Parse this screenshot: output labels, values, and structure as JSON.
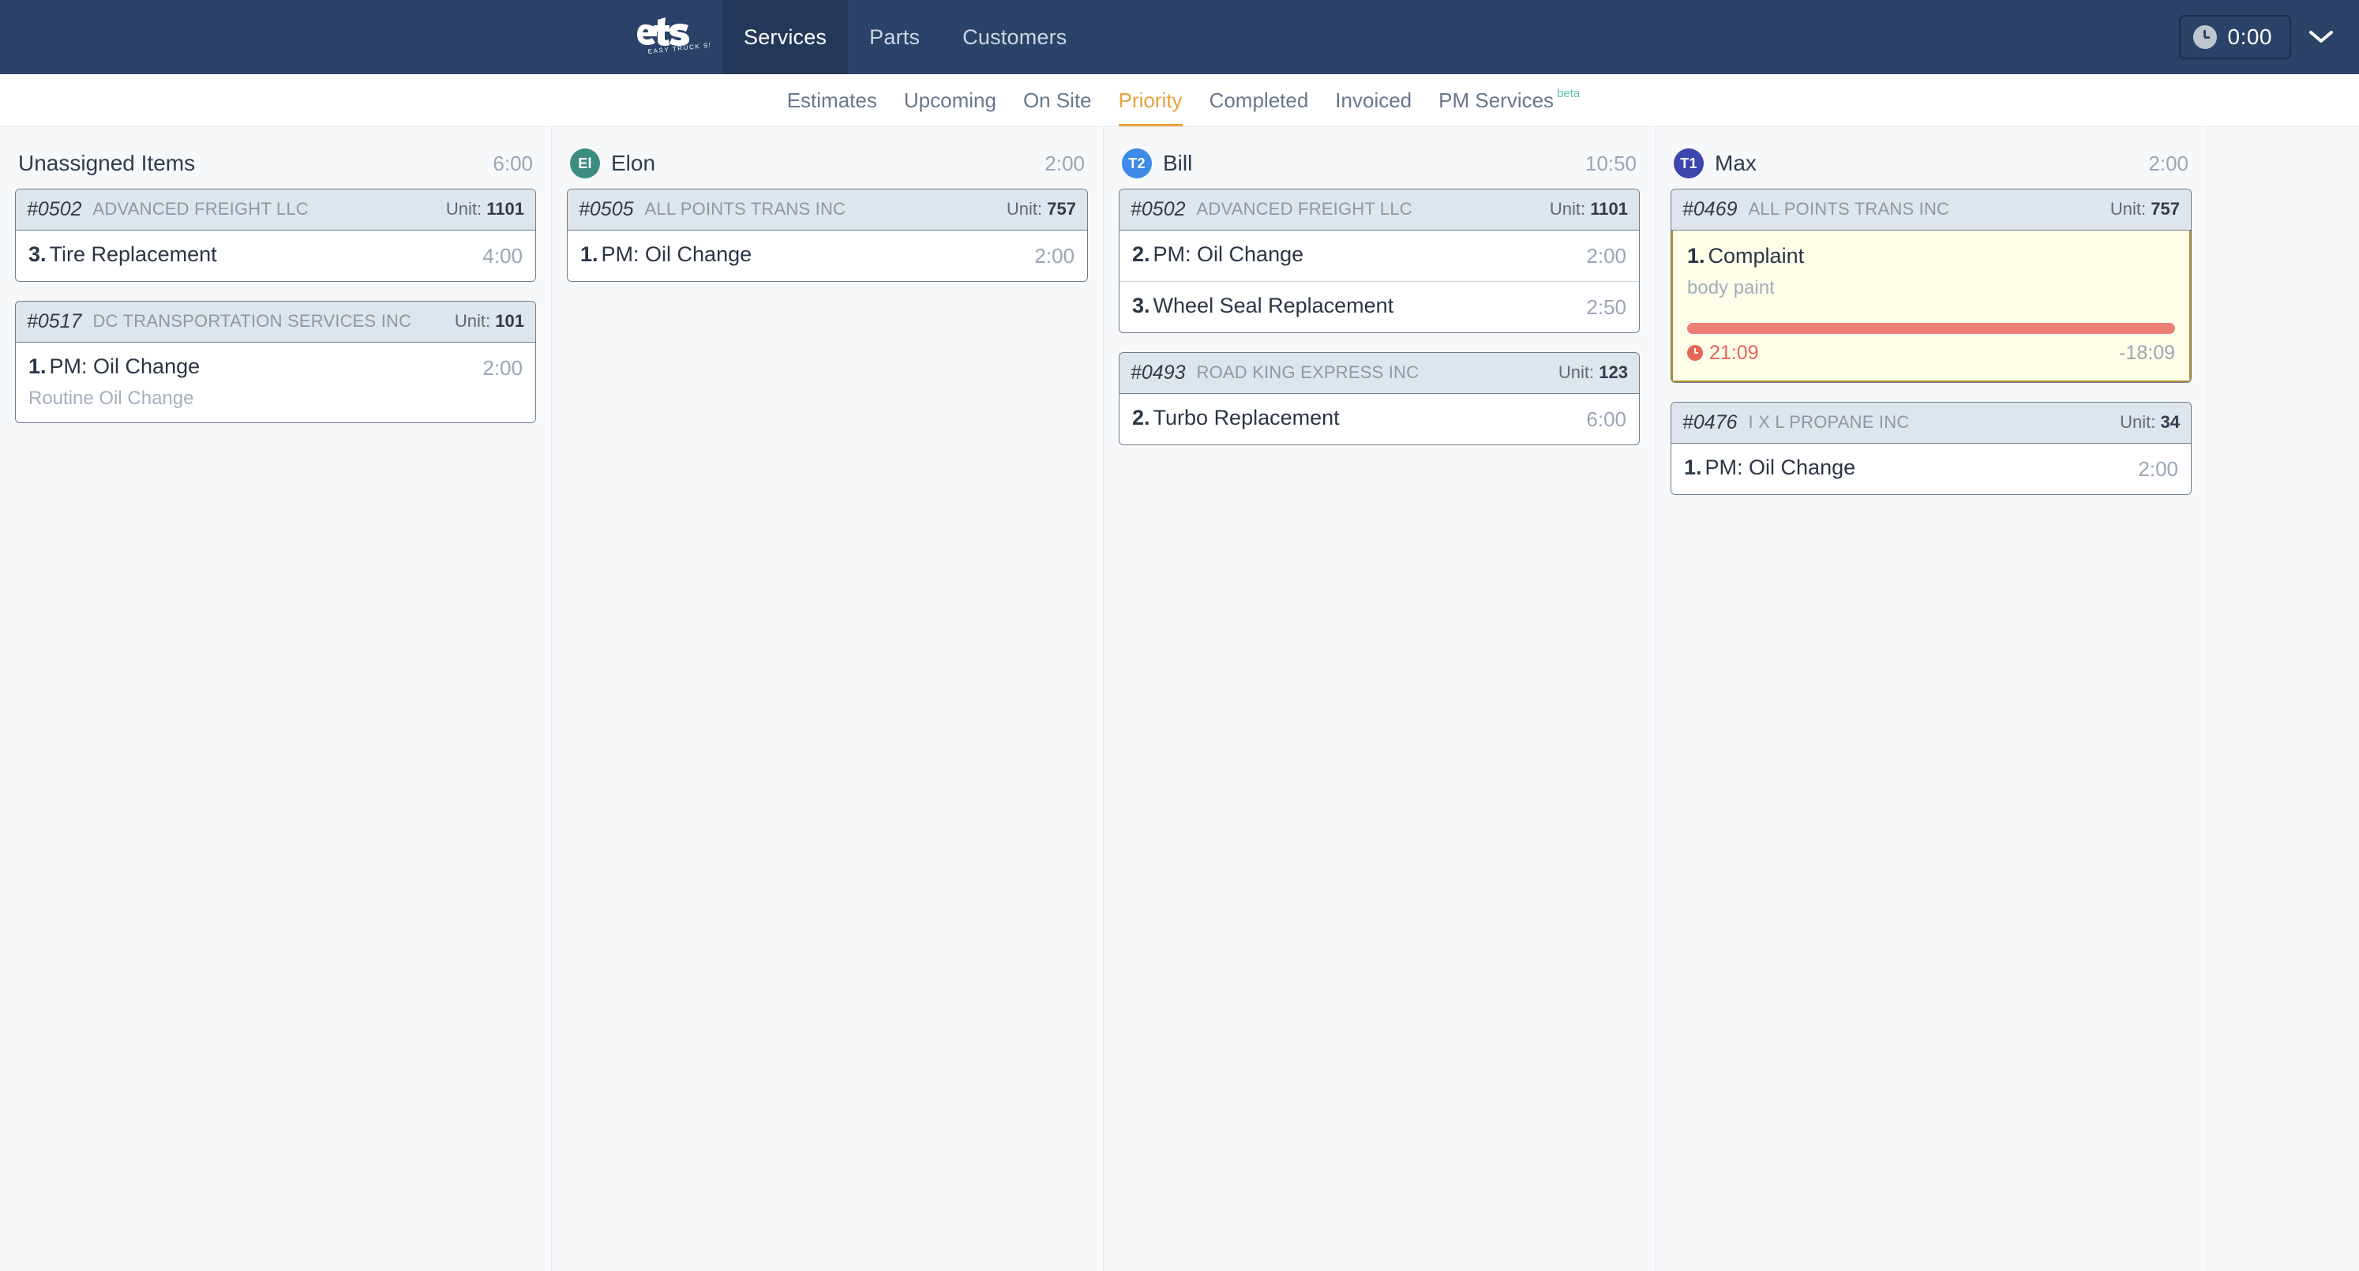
{
  "topbar": {
    "logo_name": "ets-logo",
    "logo_text": "ets",
    "logo_tagline": "EASY TRUCK SHOP",
    "nav": [
      {
        "label": "Services",
        "active": true
      },
      {
        "label": "Parts",
        "active": false
      },
      {
        "label": "Customers",
        "active": false
      }
    ],
    "timer": {
      "icon": "clock-icon",
      "value": "0:00"
    },
    "chevron": "chevron-down-icon"
  },
  "tabs": [
    {
      "label": "Estimates",
      "active": false
    },
    {
      "label": "Upcoming",
      "active": false
    },
    {
      "label": "On Site",
      "active": false
    },
    {
      "label": "Priority",
      "active": true
    },
    {
      "label": "Completed",
      "active": false
    },
    {
      "label": "Invoiced",
      "active": false
    },
    {
      "label": "PM Services",
      "active": false,
      "badge": "beta"
    }
  ],
  "colors": {
    "topbar_bg": "#2b4368",
    "accent": "#e8a33d",
    "beta": "#5bbfb0",
    "overdue": "#e8655c",
    "progress_bar": "#ec8078",
    "highlight_bg": "#fdfde8",
    "highlight_border": "#b08c2b"
  },
  "columns": [
    {
      "id": "unassigned",
      "title": "Unassigned Items",
      "total": "6:00",
      "avatar": null,
      "work_orders": [
        {
          "number": "#0502",
          "customer": "ADVANCED FREIGHT LLC",
          "unit_label": "Unit:",
          "unit": "1101",
          "wrap_unit": false,
          "tasks": [
            {
              "index": "3.",
              "title": "Tire Replacement",
              "sub": null,
              "time": "4:00",
              "highlight": false
            }
          ]
        },
        {
          "number": "#0517",
          "customer": "DC TRANSPORTATION SERVICES INC",
          "unit_label": "Unit:",
          "unit": "101",
          "wrap_unit": true,
          "tasks": [
            {
              "index": "1.",
              "title": "PM: Oil Change",
              "sub": "Routine Oil Change",
              "time": "2:00",
              "highlight": false
            }
          ]
        }
      ]
    },
    {
      "id": "elon",
      "title": "Elon",
      "total": "2:00",
      "avatar": {
        "initials": "El",
        "color": "#3c8d7f"
      },
      "work_orders": [
        {
          "number": "#0505",
          "customer": "ALL POINTS TRANS INC",
          "unit_label": "Unit:",
          "unit": "757",
          "wrap_unit": false,
          "tasks": [
            {
              "index": "1.",
              "title": "PM: Oil Change",
              "sub": null,
              "time": "2:00",
              "highlight": false
            }
          ]
        }
      ]
    },
    {
      "id": "bill",
      "title": "Bill",
      "total": "10:50",
      "avatar": {
        "initials": "T2",
        "color": "#3d8ae8"
      },
      "work_orders": [
        {
          "number": "#0502",
          "customer": "ADVANCED FREIGHT LLC",
          "unit_label": "Unit:",
          "unit": "1101",
          "wrap_unit": false,
          "tasks": [
            {
              "index": "2.",
              "title": "PM: Oil Change",
              "sub": null,
              "time": "2:00",
              "highlight": false
            },
            {
              "index": "3.",
              "title": "Wheel Seal Replacement",
              "sub": null,
              "time": "2:50",
              "highlight": false
            }
          ]
        },
        {
          "number": "#0493",
          "customer": "ROAD KING EXPRESS INC",
          "unit_label": "Unit:",
          "unit": "123",
          "wrap_unit": false,
          "tasks": [
            {
              "index": "2.",
              "title": "Turbo Replacement",
              "sub": null,
              "time": "6:00",
              "highlight": false
            }
          ]
        }
      ]
    },
    {
      "id": "max",
      "title": "Max",
      "total": "2:00",
      "avatar": {
        "initials": "T1",
        "color": "#3c46ad"
      },
      "work_orders": [
        {
          "number": "#0469",
          "customer": "ALL POINTS TRANS INC",
          "unit_label": "Unit:",
          "unit": "757",
          "wrap_unit": false,
          "tasks": [
            {
              "index": "1.",
              "title": "Complaint",
              "sub": "body paint",
              "time": null,
              "highlight": true,
              "progress_percent": 100,
              "elapsed": "21:09",
              "remaining": "-18:09"
            }
          ]
        },
        {
          "number": "#0476",
          "customer": "I X L PROPANE INC",
          "unit_label": "Unit:",
          "unit": "34",
          "wrap_unit": false,
          "tasks": [
            {
              "index": "1.",
              "title": "PM: Oil Change",
              "sub": null,
              "time": "2:00",
              "highlight": false
            }
          ]
        }
      ]
    }
  ]
}
